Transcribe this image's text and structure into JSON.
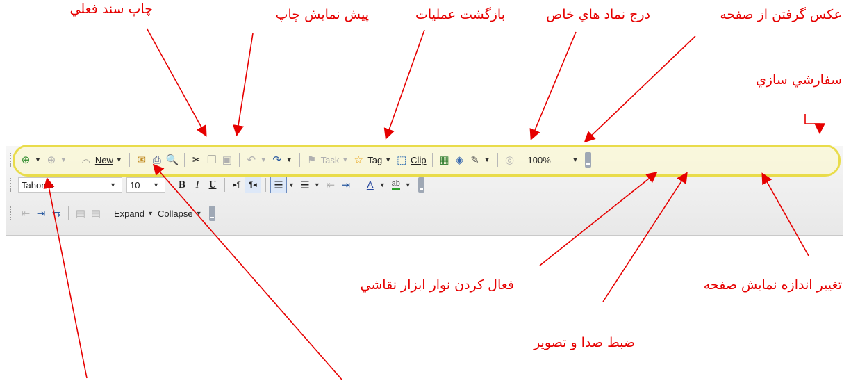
{
  "callouts": {
    "print_current": "چاپ سند فعلي",
    "print_preview": "پيش نمايش چاپ",
    "undo": "بازگشت عمليات",
    "insert_special": "درج نماد هاي خاص",
    "screen_clip": "عكس گرفتن از صفحه",
    "customize": "سفارشي سازي",
    "drawing_toolbar": "فعال كردن نوار ابزار نقاشي",
    "zoom": "تغيير اندازه نمايش صفحه",
    "record_av": "ضبط صدا و تصوير"
  },
  "toolbar1": {
    "new_label": "New",
    "task_label": "Task",
    "tag_label": "Tag",
    "clip_label": "Clip",
    "zoom_value": "100%"
  },
  "toolbar2": {
    "font_name": "Tahoma",
    "font_size": "10",
    "bold": "B",
    "italic": "I",
    "underline": "U",
    "ltr": "▸¶",
    "rtl": "¶◂",
    "font_color_glyph": "A",
    "highlight_glyph": "ab"
  },
  "toolbar3": {
    "expand_label": "Expand",
    "collapse_label": "Collapse"
  },
  "colors": {
    "callout": "#e60000",
    "highlight_border": "#e9dc4a",
    "font_color_bar": "#1a8a1a",
    "highlight_bar": "#2aa02a"
  },
  "icons": [
    "new-icon",
    "back-icon",
    "forward-icon",
    "email-icon",
    "print-icon",
    "print-preview-icon",
    "cut-icon",
    "copy-icon",
    "paste-icon",
    "undo-icon",
    "redo-icon",
    "task-flag-icon",
    "tag-star-icon",
    "screen-clip-icon",
    "table-icon",
    "drawing-icon",
    "microphone-icon",
    "help-icon",
    "bullets-icon",
    "numbering-icon",
    "outdent-icon",
    "indent-icon"
  ]
}
